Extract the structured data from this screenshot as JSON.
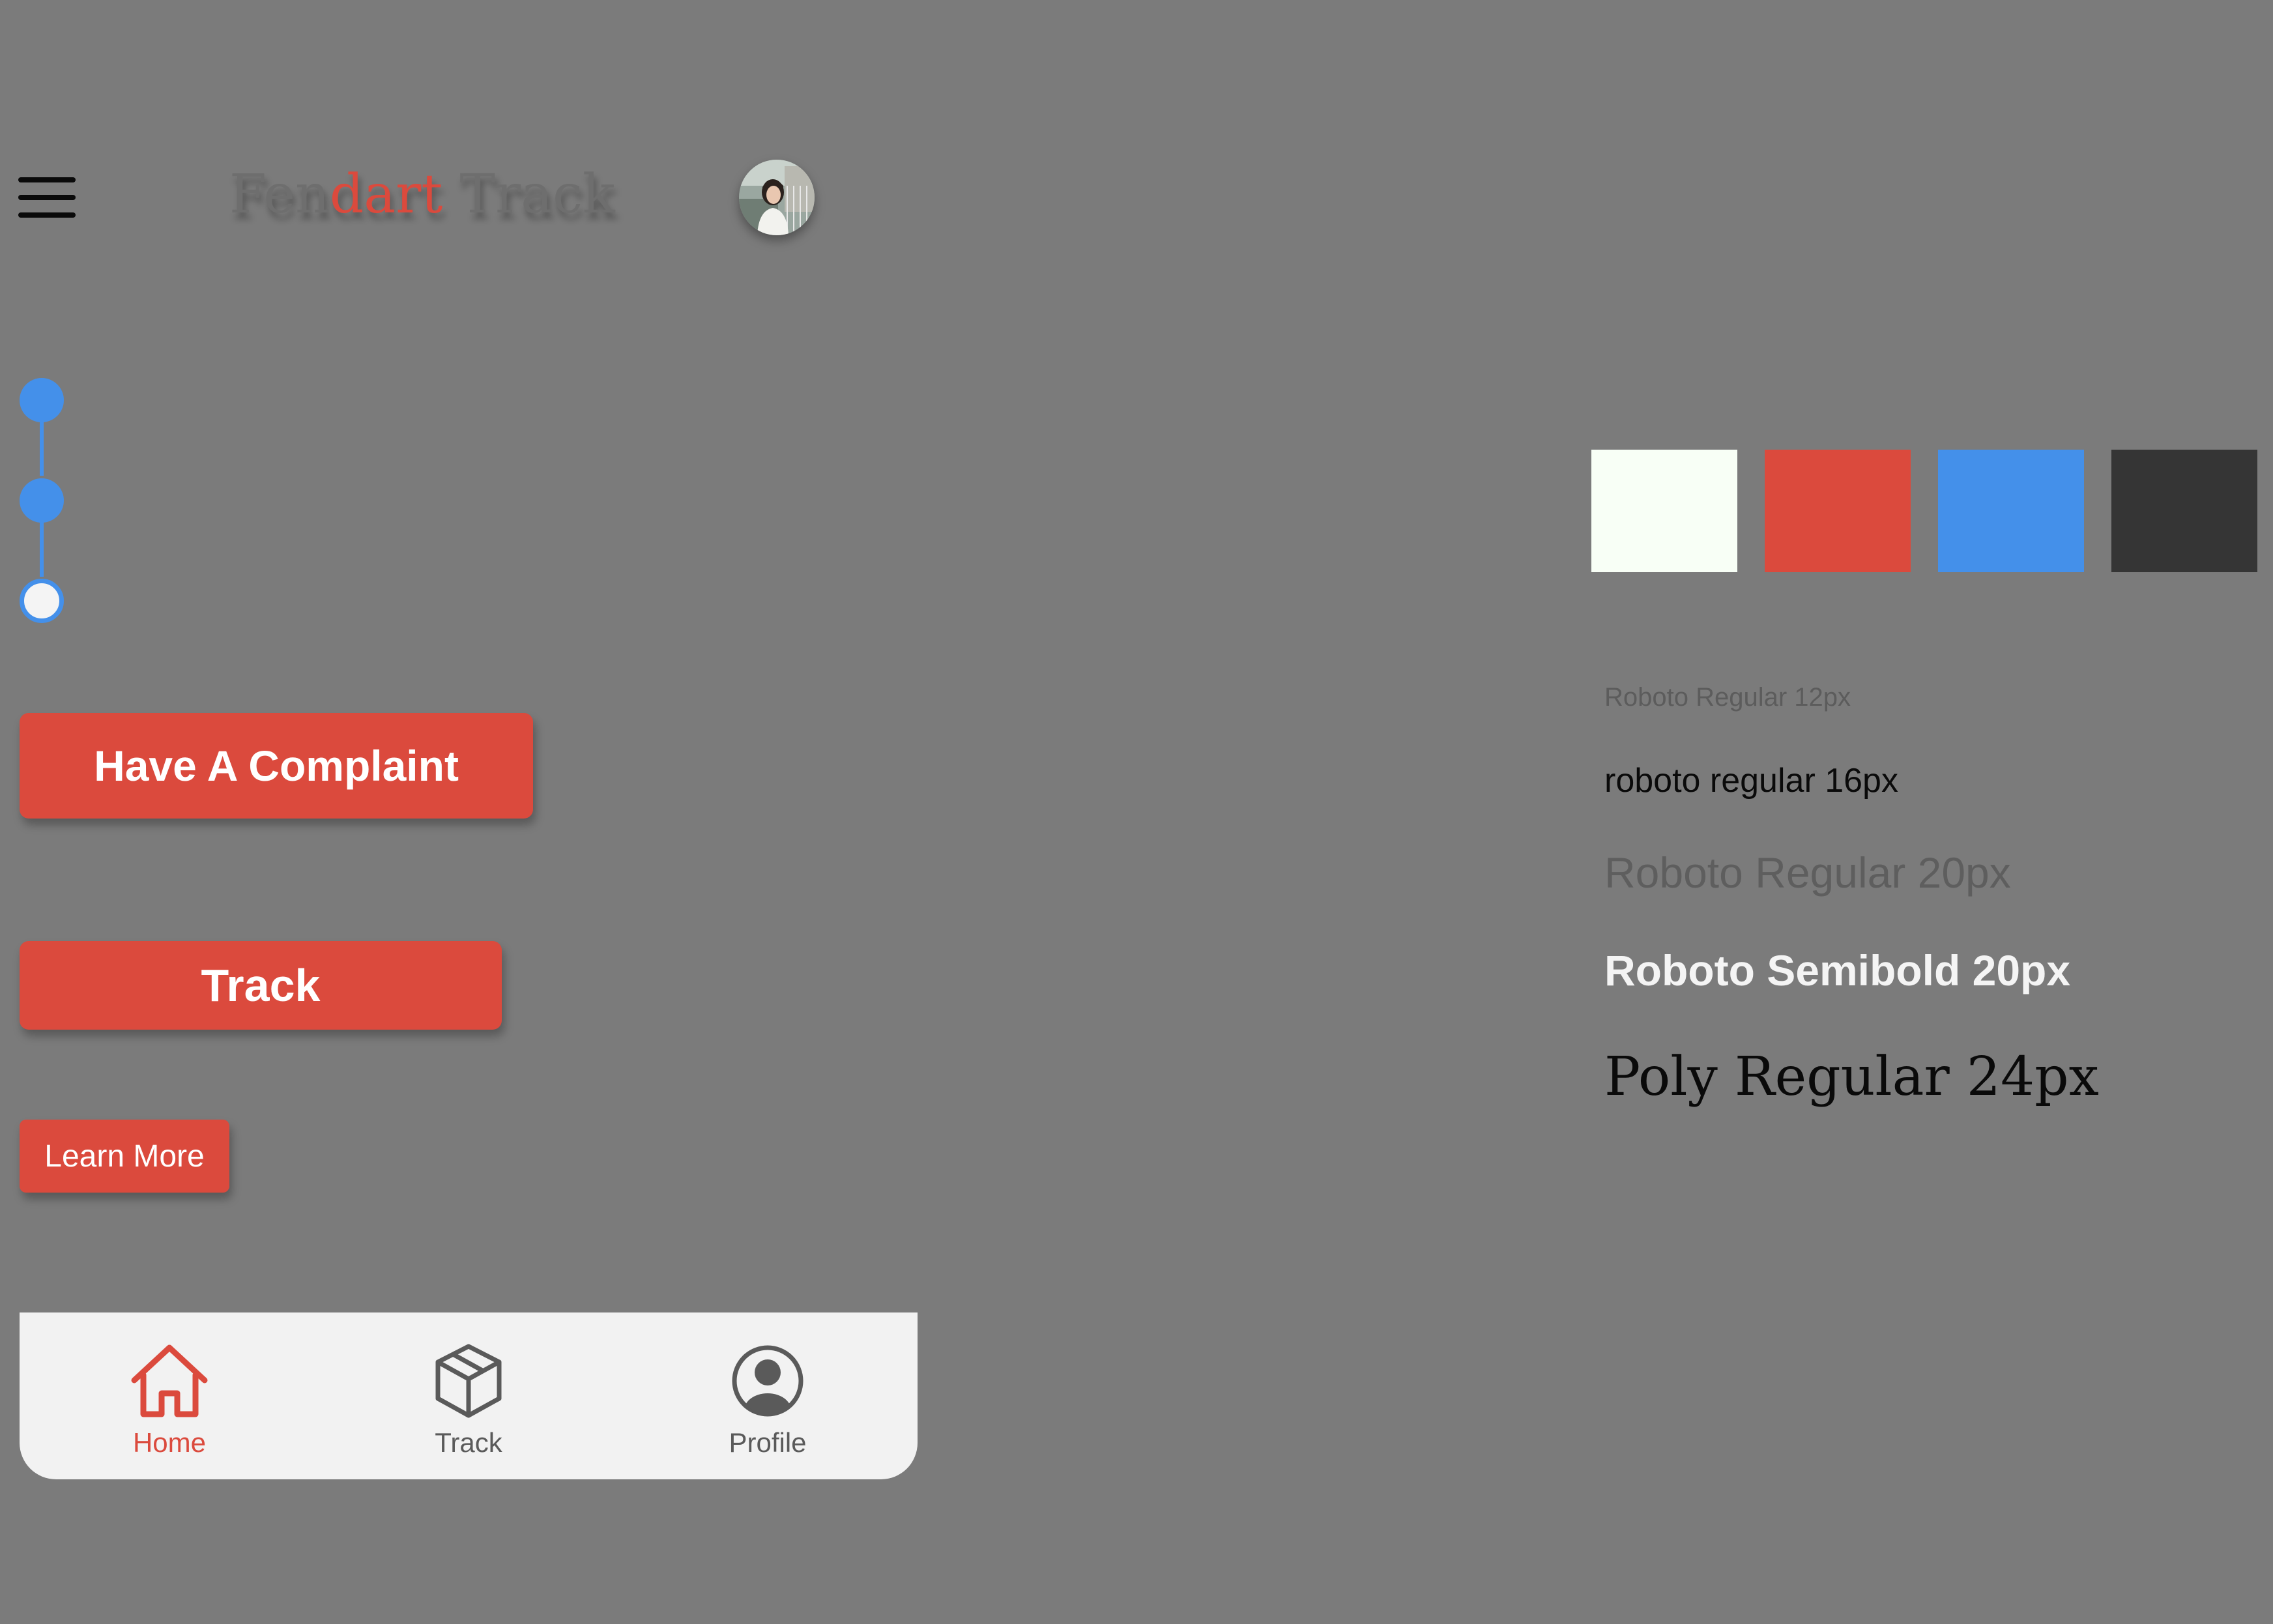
{
  "header": {
    "menu_icon": "hamburger-menu-icon",
    "title_part_1": "Fen",
    "title_part_2": "dart",
    "title_part_3": " Track",
    "avatar_alt": "User profile photo"
  },
  "stepper": {
    "steps": [
      {
        "state": "completed"
      },
      {
        "state": "completed"
      },
      {
        "state": "pending"
      }
    ]
  },
  "actions": {
    "complaint_label": "Have A Complaint",
    "track_label": "Track",
    "learn_more_label": "Learn More"
  },
  "bottom_nav": {
    "items": [
      {
        "label": "Home",
        "icon": "home-icon",
        "active": true
      },
      {
        "label": "Track",
        "icon": "box-icon",
        "active": false
      },
      {
        "label": "Profile",
        "icon": "user-circle-icon",
        "active": false
      }
    ]
  },
  "style_guide": {
    "colors": [
      "#f8fff6",
      "#db4a3d",
      "#4490ea",
      "#353535"
    ],
    "typography": [
      "Roboto Regular 12px",
      "roboto regular 16px",
      "Roboto Regular 20px",
      "Roboto Semibold 20px",
      "Poly Regular 24px"
    ]
  }
}
